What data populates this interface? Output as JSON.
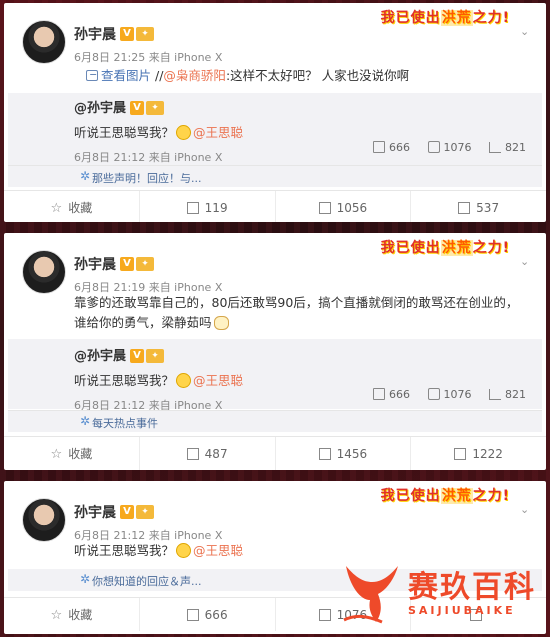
{
  "badge": {
    "pre": "我已使出",
    "hl": "洪荒",
    "post": "之力!"
  },
  "posts": [
    {
      "user": "孙宇晨",
      "vip": "V",
      "medal": "✦",
      "meta": "6月8日 21:25 来自 iPhone X",
      "text": {
        "view_pic": "查看图片",
        "sep": " //",
        "mention": "@枭商骄阳",
        "rest": ":这样不太好吧？ 人家也没说你啊"
      },
      "repost": {
        "user": "@孙宇晨",
        "text_pre": "听说王思聪骂我？",
        "mention": "@王思聪",
        "meta": "6月8日 21:12 来自 iPhone X",
        "stats": {
          "repost": "666",
          "comment": "1076",
          "like": "821"
        }
      },
      "topic": "那些声明！回应！与...",
      "actions": {
        "fav": "收藏",
        "repost": "119",
        "comment": "1056",
        "like": "537"
      }
    },
    {
      "user": "孙宇晨",
      "vip": "V",
      "medal": "✦",
      "meta": "6月8日 21:19 来自 iPhone X",
      "text": {
        "line1": "靠爹的还敢骂靠自己的，80后还敢骂90后，搞个直播就倒闭的敢骂还在创业的，",
        "line2": "谁给你的勇气，梁静茹吗"
      },
      "repost": {
        "user": "@孙宇晨",
        "text_pre": "听说王思聪骂我？",
        "mention": "@王思聪",
        "meta": "6月8日 21:12 来自 iPhone X",
        "stats": {
          "repost": "666",
          "comment": "1076",
          "like": "821"
        }
      },
      "topic": "每天热点事件",
      "actions": {
        "fav": "收藏",
        "repost": "487",
        "comment": "1456",
        "like": "1222"
      }
    },
    {
      "user": "孙宇晨",
      "vip": "V",
      "medal": "✦",
      "meta": "6月8日 21:12 来自 iPhone X",
      "text": {
        "pre": "听说王思聪骂我？",
        "mention": "@王思聪"
      },
      "topic": "你想知道的回应＆声...",
      "actions": {
        "fav": "收藏",
        "repost": "666",
        "comment": "1076"
      }
    }
  ],
  "watermark": {
    "title": "赛玖百科",
    "sub": "SAIJIUBAIKE"
  }
}
